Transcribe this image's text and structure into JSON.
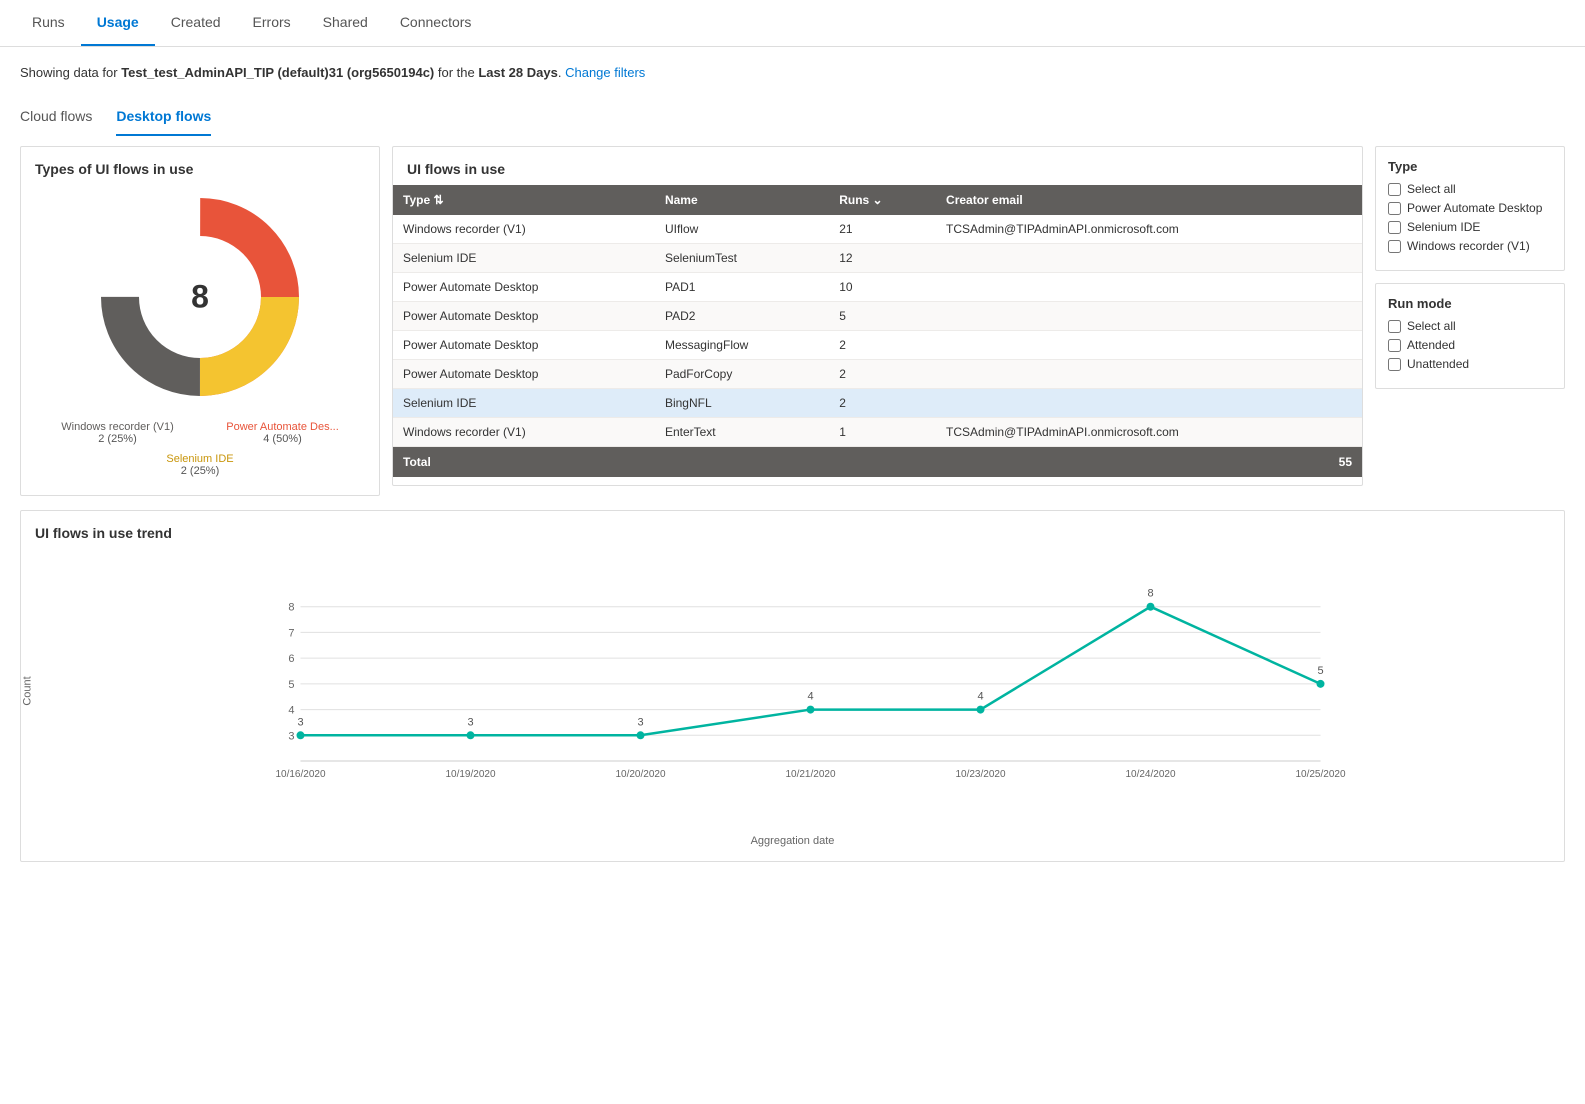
{
  "nav": {
    "items": [
      {
        "label": "Runs",
        "active": false
      },
      {
        "label": "Usage",
        "active": true
      },
      {
        "label": "Created",
        "active": false
      },
      {
        "label": "Errors",
        "active": false
      },
      {
        "label": "Shared",
        "active": false
      },
      {
        "label": "Connectors",
        "active": false
      }
    ]
  },
  "header": {
    "prefix": "Showing data for ",
    "bold": "Test_test_AdminAPI_TIP (default)31 (org5650194c)",
    "middle": " for the ",
    "period": "Last 28 Days",
    "suffix": ".",
    "link": "Change filters"
  },
  "flow_tabs": [
    {
      "label": "Cloud flows",
      "active": false
    },
    {
      "label": "Desktop flows",
      "active": true
    }
  ],
  "donut_card": {
    "title": "Types of UI flows in use",
    "center_value": "8",
    "segments": [
      {
        "label": "Power Automate Des...",
        "sub": "4 (50%)",
        "color": "#e8543a",
        "percent": 50
      },
      {
        "label": "Selenium IDE",
        "sub": "2 (25%)",
        "color": "#f4c430",
        "percent": 25
      },
      {
        "label": "Windows recorder (V1)",
        "sub": "2 (25%)",
        "color": "#605e5c",
        "percent": 25
      }
    ]
  },
  "table_card": {
    "title": "UI flows in use",
    "columns": [
      "Type",
      "Name",
      "Runs",
      "Creator email"
    ],
    "rows": [
      {
        "type": "Windows recorder (V1)",
        "name": "UIflow",
        "runs": 21,
        "email": "TCSAdmin@TIPAdminAPI.onmicrosoft.com",
        "highlight": false
      },
      {
        "type": "Selenium IDE",
        "name": "SeleniumTest",
        "runs": 12,
        "email": "",
        "highlight": false
      },
      {
        "type": "Power Automate Desktop",
        "name": "PAD1",
        "runs": 10,
        "email": "",
        "highlight": false
      },
      {
        "type": "Power Automate Desktop",
        "name": "PAD2",
        "runs": 5,
        "email": "",
        "highlight": false
      },
      {
        "type": "Power Automate Desktop",
        "name": "MessagingFlow",
        "runs": 2,
        "email": "",
        "highlight": false
      },
      {
        "type": "Power Automate Desktop",
        "name": "PadForCopy",
        "runs": 2,
        "email": "",
        "highlight": false
      },
      {
        "type": "Selenium IDE",
        "name": "BingNFL",
        "runs": 2,
        "email": "",
        "highlight": true
      },
      {
        "type": "Windows recorder (V1)",
        "name": "EnterText",
        "runs": 1,
        "email": "TCSAdmin@TIPAdminAPI.onmicrosoft.com",
        "highlight": false
      }
    ],
    "footer": {
      "label": "Total",
      "runs": 55
    }
  },
  "type_filter": {
    "title": "Type",
    "options": [
      {
        "label": "Select all",
        "checked": false
      },
      {
        "label": "Power Automate Desktop",
        "checked": false
      },
      {
        "label": "Selenium IDE",
        "checked": false
      },
      {
        "label": "Windows recorder (V1)",
        "checked": false
      }
    ]
  },
  "runmode_filter": {
    "title": "Run mode",
    "options": [
      {
        "label": "Select all",
        "checked": false
      },
      {
        "label": "Attended",
        "checked": false
      },
      {
        "label": "Unattended",
        "checked": false
      }
    ]
  },
  "trend_card": {
    "title": "UI flows in use trend",
    "y_label": "Count",
    "x_label": "Aggregation date",
    "y_max": 8,
    "y_min": 3,
    "data_points": [
      {
        "date": "10/16/2020",
        "value": 3
      },
      {
        "date": "10/19/2020",
        "value": 3
      },
      {
        "date": "10/20/2020",
        "value": 3
      },
      {
        "date": "10/21/2020",
        "value": 4
      },
      {
        "date": "10/23/2020",
        "value": 4
      },
      {
        "date": "10/24/2020",
        "value": 8
      },
      {
        "date": "10/25/2020",
        "value": 5
      }
    ],
    "y_ticks": [
      3,
      4,
      5,
      6,
      7,
      8
    ],
    "line_color": "#00b4a0"
  }
}
